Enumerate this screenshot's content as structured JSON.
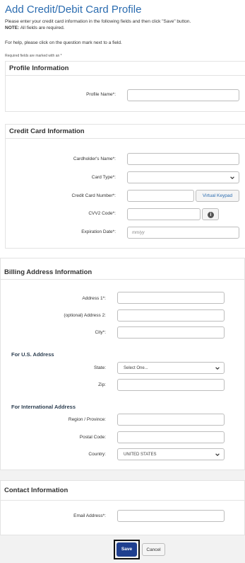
{
  "page": {
    "title": "Add Credit/Debit Card Profile",
    "intro_line1": "Please enter your credit card information in the following fields and then click \"Save\" button.",
    "note_label": "NOTE:",
    "note_text": "All fields are required.",
    "help_line": "For help, please click on the question mark next to a field.",
    "required_note": "Required fields are marked with an *"
  },
  "profile": {
    "heading": "Profile Information",
    "name_label": "Profile Name*:"
  },
  "credit_card": {
    "heading": "Credit Card Information",
    "holder_label": "Cardholder's Name*:",
    "type_label": "Card Type*:",
    "number_label": "Credit Card Number*:",
    "keypad_label": "Virtual Keypad",
    "cvv_label": "CVV2 Code*:",
    "expiry_label": "Expiration Date*:",
    "expiry_placeholder": "mm/yy"
  },
  "billing": {
    "heading": "Billing Address Information",
    "address1_label": "Address 1*:",
    "address2_label": "(optional) Address 2:",
    "city_label": "City*:",
    "us_heading": "For U.S. Address",
    "state_label": "State:",
    "state_value": "Select One...",
    "zip_label": "Zip:",
    "intl_heading": "For International Address",
    "region_label": "Region / Province:",
    "postal_label": "Postal Code:",
    "country_label": "Country:",
    "country_value": "UNITED STATES"
  },
  "contact": {
    "heading": "Contact Information",
    "email_label": "Email Address*:"
  },
  "actions": {
    "save_label": "Save",
    "cancel_label": "Cancel"
  },
  "icons": {
    "info": "info-circle-icon",
    "dropdown": "chevron-down-icon"
  },
  "colors": {
    "title": "#2b6cb0",
    "save_button": "#1f3f8f",
    "link": "#2b6cb0"
  }
}
